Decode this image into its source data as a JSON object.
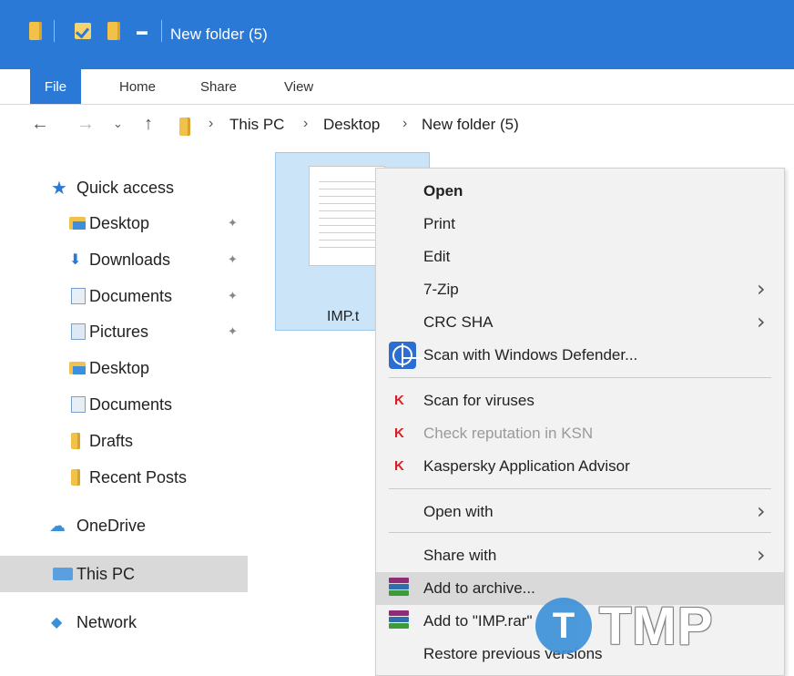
{
  "window": {
    "title": "New folder (5)",
    "accent_color": "#2b79d7"
  },
  "ribbon": {
    "tabs": [
      "File",
      "Home",
      "Share",
      "View"
    ]
  },
  "address": {
    "crumbs": [
      "This PC",
      "Desktop",
      "New folder (5)"
    ]
  },
  "nav_pane": {
    "quick_access": "Quick access",
    "items": [
      {
        "label": "Desktop",
        "icon": "desktop-folder-icon",
        "pinned": true
      },
      {
        "label": "Downloads",
        "icon": "downloads-folder-icon",
        "pinned": true
      },
      {
        "label": "Documents",
        "icon": "documents-folder-icon",
        "pinned": true
      },
      {
        "label": "Pictures",
        "icon": "pictures-folder-icon",
        "pinned": true
      },
      {
        "label": "Desktop",
        "icon": "desktop-folder-icon",
        "pinned": false
      },
      {
        "label": "Documents",
        "icon": "documents-folder-icon",
        "pinned": false
      },
      {
        "label": "Drafts",
        "icon": "folder-icon",
        "pinned": false
      },
      {
        "label": "Recent Posts",
        "icon": "folder-icon",
        "pinned": false
      }
    ],
    "onedrive": "OneDrive",
    "this_pc": "This PC",
    "network": "Network"
  },
  "file": {
    "name": "IMP.t"
  },
  "context_menu": {
    "items": [
      {
        "label": "Open",
        "bold": true
      },
      {
        "label": "Print"
      },
      {
        "label": "Edit"
      },
      {
        "label": "7-Zip",
        "submenu": true
      },
      {
        "label": "CRC SHA",
        "submenu": true
      },
      {
        "label": "Scan with Windows Defender...",
        "icon": "windows-defender-icon"
      },
      {
        "label": "Scan for viruses",
        "icon": "kaspersky-icon"
      },
      {
        "label": "Check reputation in KSN",
        "icon": "kaspersky-icon",
        "disabled": true
      },
      {
        "label": "Kaspersky Application Advisor",
        "icon": "kaspersky-icon"
      },
      {
        "label": "Open with",
        "submenu": true
      },
      {
        "label": "Share with",
        "submenu": true
      },
      {
        "label": "Add to archive...",
        "icon": "winrar-icon",
        "highlighted": true
      },
      {
        "label": "Add to \"IMP.rar\"",
        "icon": "winrar-icon"
      },
      {
        "label": "Restore previous versions"
      }
    ]
  },
  "watermark": {
    "letter": "T",
    "text": "TMP"
  }
}
